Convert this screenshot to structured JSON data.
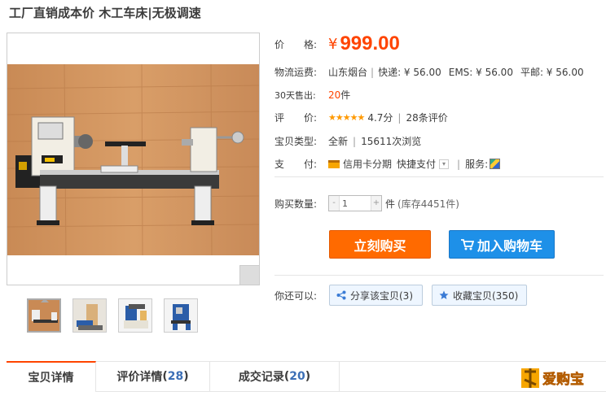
{
  "title": "工厂直销成本价 木工车床|无极调速",
  "price": {
    "label": "价　　格:",
    "currency": "¥",
    "value": "999.00"
  },
  "shipping": {
    "label": "物流运费:",
    "origin": "山东烟台",
    "express": "快递: ¥ 56.00",
    "ems": "EMS: ¥ 56.00",
    "surface": "平邮: ¥ 56.00"
  },
  "sales": {
    "label": "30天售出:",
    "count": "20",
    "unit": "件"
  },
  "rating": {
    "label": "评　　价:",
    "stars": "★★★★★",
    "score": "4.7分",
    "reviews": "28条评价"
  },
  "type": {
    "label": "宝贝类型:",
    "condition": "全新",
    "views": "15611次浏览"
  },
  "payment": {
    "label": "支　　付:",
    "credit": "信用卡分期",
    "quick": "快捷支付",
    "service_label": "服务:"
  },
  "quantity": {
    "label": "购买数量:",
    "value": "1",
    "unit": "件",
    "stock": "(库存4451件)",
    "minus": "-",
    "plus": "+"
  },
  "buttons": {
    "buy": "立刻购买",
    "cart": "加入购物车"
  },
  "extras": {
    "label": "你还可以:",
    "share": "分享该宝贝(3)",
    "favorite": "收藏宝贝(350)"
  },
  "tabs": [
    {
      "label": "宝贝详情",
      "count": ""
    },
    {
      "label": "评价详情",
      "count": "28"
    },
    {
      "label": "成交记录",
      "count": "20"
    }
  ],
  "logo_text": "爱购宝",
  "colors": {
    "accent": "#ff4400",
    "buy": "#ff6a00",
    "cart": "#1e90e8"
  },
  "icons": [
    "zoom-icon",
    "credit-card-icon",
    "chevron-down-icon",
    "service-icon",
    "cart-icon",
    "share-icon",
    "star-icon"
  ]
}
